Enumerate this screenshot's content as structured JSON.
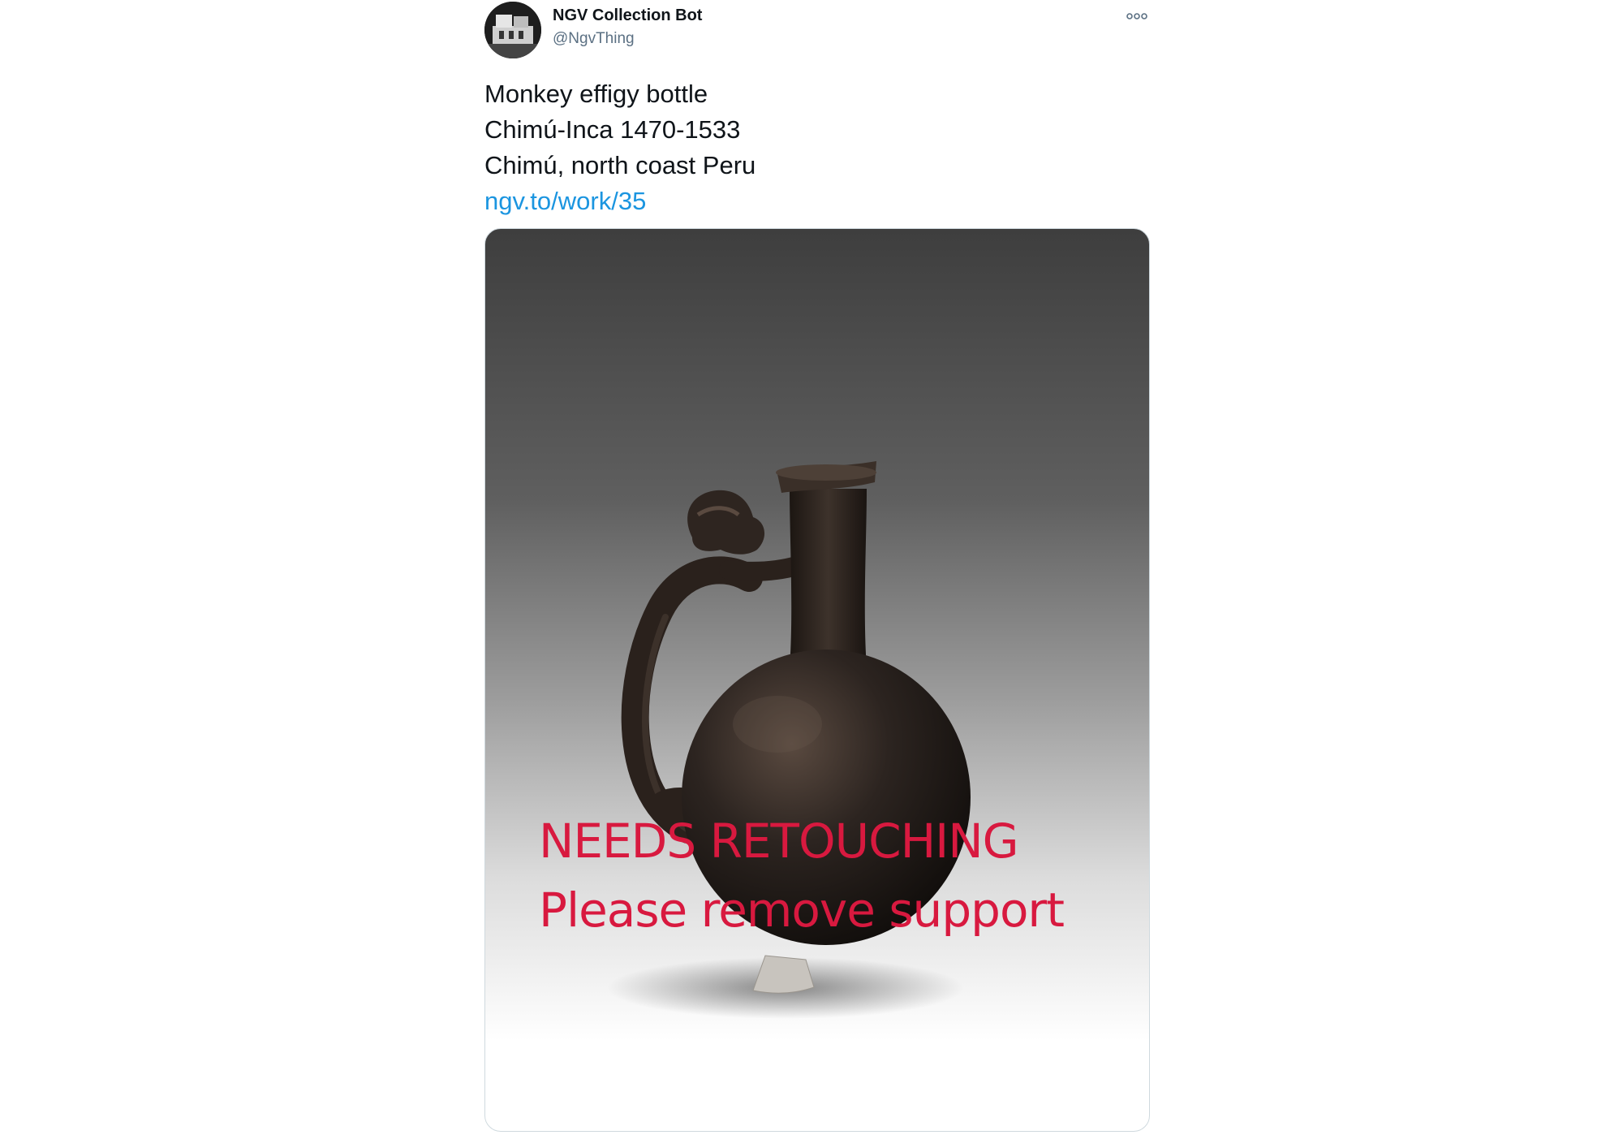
{
  "tweet": {
    "author": {
      "display_name": "NGV Collection Bot",
      "handle": "@NgvThing",
      "avatar_icon": "avatar-icon"
    },
    "more_icon": "more-dots-icon",
    "text_lines": [
      "Monkey effigy bottle",
      "Chimú-Inca 1470-1533",
      "Chimú, north coast Peru"
    ],
    "link": "ngv.to/work/35",
    "media": {
      "overlay_line_1": "NEEDS RETOUCHING",
      "overlay_line_2": "Please remove support",
      "overlay_color": "#d8193f"
    }
  },
  "colors": {
    "link": "#1b95e0",
    "text": "#0f1419",
    "muted": "#5b7083"
  }
}
